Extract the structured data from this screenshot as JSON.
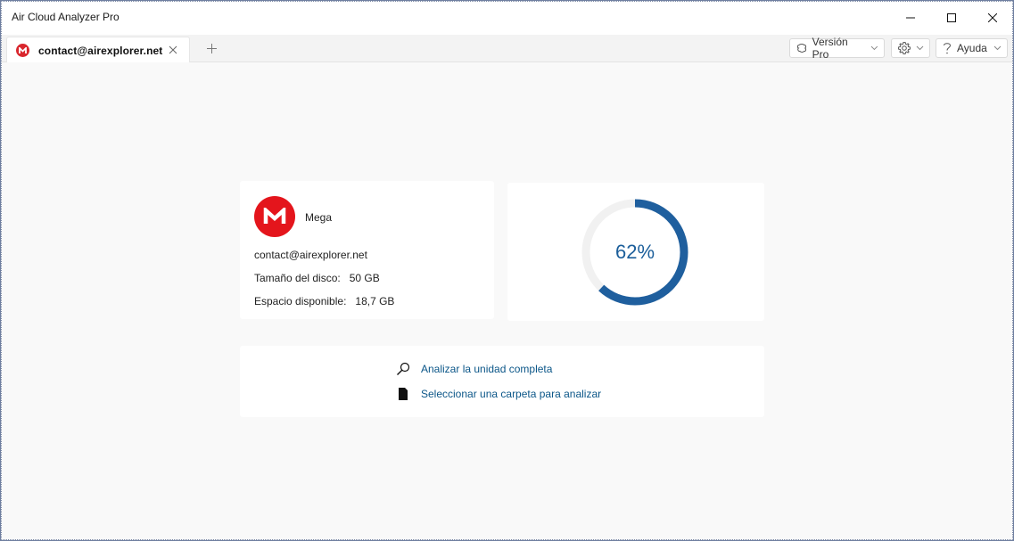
{
  "window": {
    "title": "Air Cloud Analyzer Pro"
  },
  "tabs": [
    {
      "label": "contact@airexplorer.net",
      "icon": "mega-logo-icon"
    }
  ],
  "toolbar": {
    "pro_label": "Versión Pro",
    "help_label": "Ayuda"
  },
  "account": {
    "service": "Mega",
    "email": "contact@airexplorer.net",
    "disk_size_label": "Tamaño del disco:",
    "disk_size_value": "50 GB",
    "free_space_label": "Espacio disponible:",
    "free_space_value": "18,7 GB"
  },
  "usage": {
    "percent_text": "62%",
    "fraction": 0.62,
    "color": "#1f5f9e",
    "track_color": "#f1f1f1"
  },
  "actions": {
    "analyze_label": "Analizar la unidad completa",
    "select_folder_label": "Seleccionar una carpeta para analizar"
  },
  "colors": {
    "mega_red": "#e4151c",
    "link": "#0b5688"
  }
}
